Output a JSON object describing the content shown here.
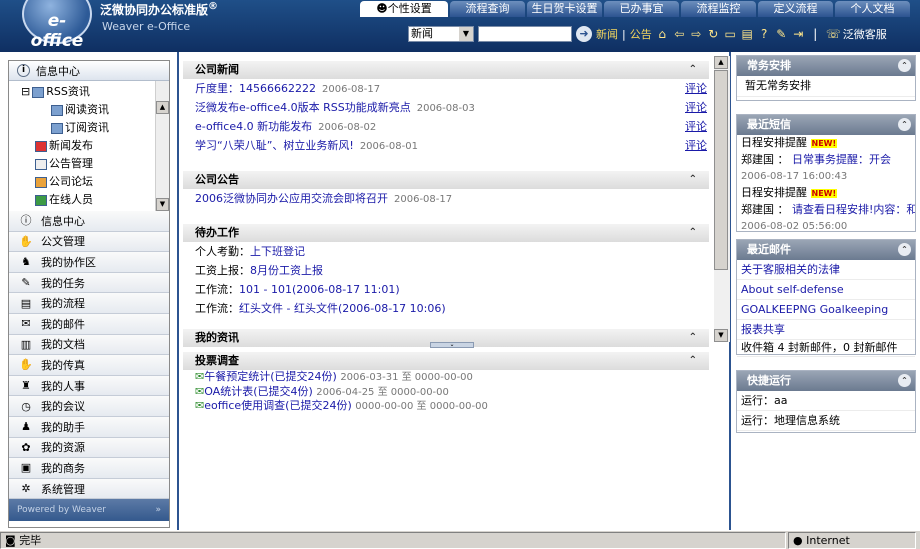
{
  "app": {
    "logo": "e-office",
    "product_name": "泛微协同办公标准版",
    "product_mark": "®",
    "subtitle": "Weaver e-Office"
  },
  "tabs": [
    {
      "label": "个性设置",
      "active": true
    },
    {
      "label": "流程查询"
    },
    {
      "label": "生日贺卡设置"
    },
    {
      "label": "已办事宜"
    },
    {
      "label": "流程监控"
    },
    {
      "label": "定义流程"
    },
    {
      "label": "个人文档"
    }
  ],
  "toolbar": {
    "search_type": "新闻",
    "search_value": "",
    "links": [
      "新闻",
      "公告"
    ],
    "service_label": "泛微客服"
  },
  "left": {
    "tree_header": "信息中心",
    "tree": [
      {
        "label": "RSS资讯"
      },
      {
        "label": "阅读资讯"
      },
      {
        "label": "订阅资讯"
      },
      {
        "label": "新闻发布"
      },
      {
        "label": "公告管理"
      },
      {
        "label": "公司论坛"
      },
      {
        "label": "在线人员"
      }
    ],
    "menu": [
      {
        "label": "信息中心",
        "icon": "info-icon"
      },
      {
        "label": "公文管理",
        "icon": "hand-icon"
      },
      {
        "label": "我的协作区",
        "icon": "users-icon"
      },
      {
        "label": "我的任务",
        "icon": "task-icon"
      },
      {
        "label": "我的流程",
        "icon": "flow-icon"
      },
      {
        "label": "我的邮件",
        "icon": "mail-icon"
      },
      {
        "label": "我的文档",
        "icon": "book-icon"
      },
      {
        "label": "我的传真",
        "icon": "fax-icon"
      },
      {
        "label": "我的人事",
        "icon": "hr-icon"
      },
      {
        "label": "我的会议",
        "icon": "meeting-icon"
      },
      {
        "label": "我的助手",
        "icon": "assistant-icon"
      },
      {
        "label": "我的资源",
        "icon": "resource-icon"
      },
      {
        "label": "我的商务",
        "icon": "business-icon"
      },
      {
        "label": "系统管理",
        "icon": "system-icon"
      }
    ],
    "footer": "Powered by Weaver"
  },
  "news": {
    "title": "公司新闻",
    "items": [
      {
        "text": "斤度里：14566662222",
        "date": "2006-08-17",
        "action": "评论"
      },
      {
        "text": "泛微发布e-office4.0版本 RSS功能成新亮点",
        "date": "2006-08-03",
        "action": "评论"
      },
      {
        "text": "e-office4.0 新功能发布",
        "date": "2006-08-02",
        "action": "评论"
      },
      {
        "text": "学习“八荣八耻”、树立业务新风!",
        "date": "2006-08-01",
        "action": "评论"
      }
    ]
  },
  "notice": {
    "title": "公司公告",
    "items": [
      {
        "text": "2006泛微协同办公应用交流会即将召开",
        "date": "2006-08-17"
      }
    ]
  },
  "todo": {
    "title": "待办工作",
    "items": [
      {
        "label": "个人考勤：",
        "text": "上下班登记"
      },
      {
        "label": "工资上报：",
        "text": "8月份工资上报"
      },
      {
        "label": "工作流：",
        "text": "101 - 101(2006-08-17 11:01)"
      },
      {
        "label": "工作流：",
        "text": "红头文件 - 红头文件(2006-08-17 10:06)"
      }
    ]
  },
  "myinfo": {
    "title": "我的资讯"
  },
  "vote": {
    "title": "投票调查",
    "items": [
      {
        "text": "午餐预定统计(已提交24份)",
        "dates": "2006-03-31 至 0000-00-00"
      },
      {
        "text": "OA统计表(已提交4份)",
        "dates": "2006-04-25 至 0000-00-00"
      },
      {
        "text": "eoffice使用调查(已提交24份)",
        "dates": "0000-00-00 至 0000-00-00"
      }
    ]
  },
  "right": {
    "schedule": {
      "title": "常务安排",
      "empty": "暂无常务安排"
    },
    "sms": {
      "title": "最近短信",
      "new_tag": "NEW!",
      "items": [
        {
          "type": "日程安排提醒",
          "sender": "郑建国 ：",
          "text": "日常事务提醒：开会",
          "time": "2006-08-17 16:00:43"
        },
        {
          "type": "日程安排提醒",
          "sender": "郑建国 ：",
          "text": "请查看日程安排!内容：和领导开会",
          "time": "2006-08-02 05:56:00"
        }
      ]
    },
    "mail": {
      "title": "最近邮件",
      "items": [
        "关于客服相关的法律",
        "About self-defense",
        "GOALKEEPNG Goalkeeping",
        "报表共享"
      ],
      "summary": "收件箱   4 封新邮件，0 封新邮件"
    },
    "quickrun": {
      "title": "快捷运行",
      "items": [
        "运行：aa",
        "运行：地理信息系统"
      ]
    }
  },
  "status": {
    "text": "完毕",
    "zone": "Internet"
  }
}
